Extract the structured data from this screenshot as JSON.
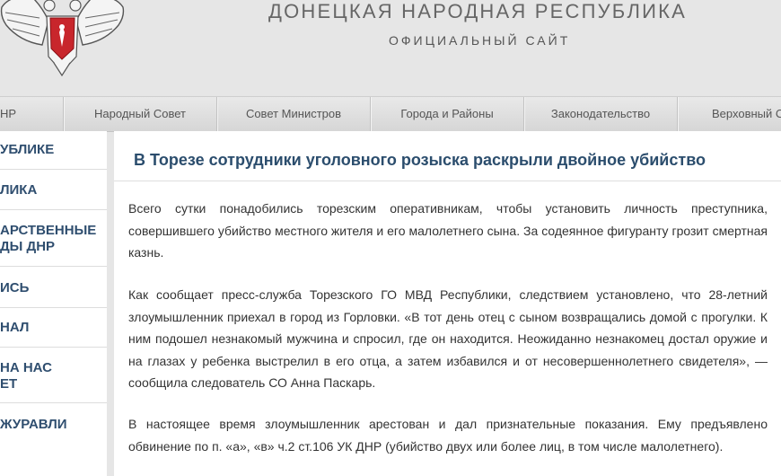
{
  "header": {
    "title": "ДОНЕЦКАЯ НАРОДНАЯ РЕСПУБЛИКА",
    "subtitle": "ОФИЦИАЛЬНЫЙ САЙТ"
  },
  "nav": {
    "items": [
      "НР",
      "Народный Совет",
      "Совет Министров",
      "Города и Районы",
      "Законодательство",
      "Верховный С"
    ]
  },
  "sidebar": {
    "items": [
      {
        "line1": "УБЛИКЕ",
        "line2": ""
      },
      {
        "line1": "ЛИКА",
        "line2": ""
      },
      {
        "line1": "АРСТВЕННЫЕ",
        "line2": "ДЫ ДНР"
      },
      {
        "line1": "ИСЬ",
        "line2": ""
      },
      {
        "line1": "НАЛ",
        "line2": ""
      },
      {
        "line1": "НА НАС",
        "line2": "ЕТ"
      },
      {
        "line1": "ЖУРАВЛИ",
        "line2": ""
      }
    ]
  },
  "article": {
    "title": "В Торезе сотрудники уголовного розыска раскрыли двойное убийство",
    "paragraphs": [
      "Всего сутки понадобились торезским оперативникам, чтобы установить личность преступника, совершившего убийство местного жителя и его малолетнего сына. За содеянное фигуранту грозит смертная казнь.",
      "Как сообщает пресс-служба Торезского ГО МВД Республики, следствием установлено, что 28-летний злоумышленник приехал в город из Горловки. «В тот день отец с сыном возвращались домой с прогулки. К ним подошел незнакомый мужчина и спросил, где он находится. Неожиданно незнакомец достал оружие и на глазах у ребенка выстрелил в его отца, а затем избавился и от несовершеннолетнего свидетеля», — сообщила следователь СО Анна Паскарь.",
      "В настоящее время злоумышленник арестован и дал признательные показания. Ему предъявлено обвинение по п. «а», «в» ч.2 ст.106 УК ДНР (убийство двух или более лиц, в том числе малолетнего)."
    ]
  },
  "colors": {
    "background": "#e6e6e6",
    "link_blue": "#2f4e6f",
    "emblem_red": "#c8262c",
    "emblem_gold": "#d4a93a"
  },
  "icons": {
    "emblem": "double-headed-eagle-coat-of-arms"
  }
}
